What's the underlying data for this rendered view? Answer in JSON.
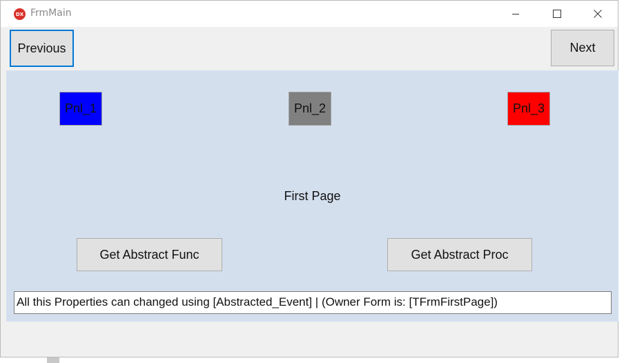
{
  "window": {
    "title": "FrmMain",
    "app_icon_text": "DX"
  },
  "toolbar": {
    "previous_label": "Previous",
    "next_label": "Next"
  },
  "page": {
    "panels": [
      {
        "label": "Pnl_1",
        "color": "#0000ff"
      },
      {
        "label": "Pnl_2",
        "color": "#808080"
      },
      {
        "label": "Pnl_3",
        "color": "#ff0000"
      }
    ],
    "title": "First Page",
    "func_button_label": "Get Abstract Func",
    "proc_button_label": "Get Abstract Proc",
    "status_text": "All this Properties can changed using [Abstracted_Event] | (Owner Form is: [TFrmFirstPage])",
    "background_color": "#d4dfee"
  }
}
